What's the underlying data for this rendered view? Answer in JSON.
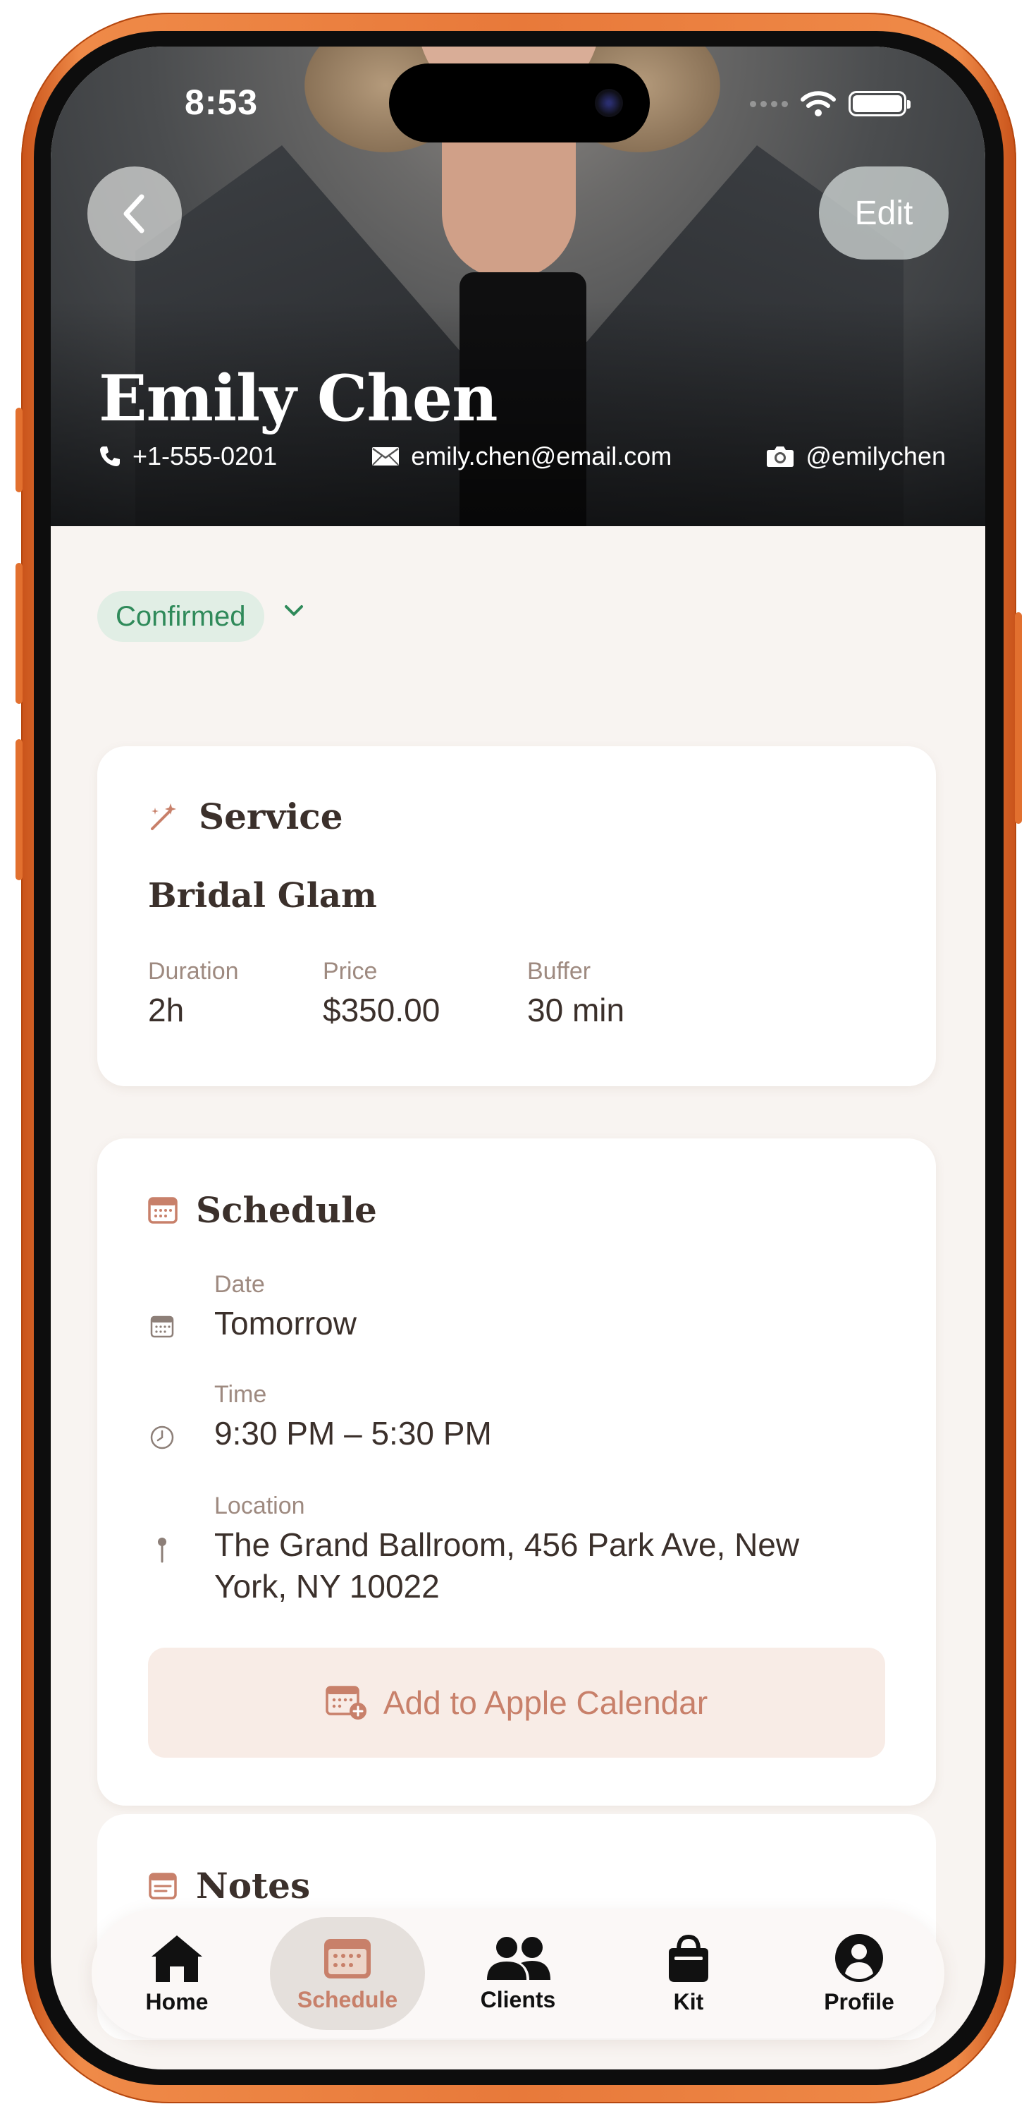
{
  "status_bar": {
    "time": "8:53"
  },
  "header": {
    "back_icon": "chevron-left-icon",
    "edit_label": "Edit",
    "name": "Emily Chen",
    "phone": "+1-555-0201",
    "email": "emily.chen@email.com",
    "instagram": "@emilychen"
  },
  "booking_status": {
    "label": "Confirmed",
    "color": "#2f8a5a"
  },
  "service": {
    "title": "Service",
    "name": "Bridal Glam",
    "stats": [
      {
        "label": "Duration",
        "value": "2h"
      },
      {
        "label": "Price",
        "value": "$350.00"
      },
      {
        "label": "Buffer",
        "value": "30 min"
      }
    ]
  },
  "schedule": {
    "title": "Schedule",
    "date_label": "Date",
    "date_value": "Tomorrow",
    "time_label": "Time",
    "time_value": "9:30 PM – 5:30 PM",
    "location_label": "Location",
    "location_value": "The Grand Ballroom, 456 Park Ave, New York, NY 10022",
    "calendar_button": "Add to Apple Calendar"
  },
  "notes": {
    "title": "Notes"
  },
  "tabbar": {
    "items": [
      {
        "label": "Home",
        "icon": "home-icon"
      },
      {
        "label": "Schedule",
        "icon": "calendar-icon"
      },
      {
        "label": "Clients",
        "icon": "clients-icon"
      },
      {
        "label": "Kit",
        "icon": "bag-icon"
      },
      {
        "label": "Profile",
        "icon": "profile-icon"
      }
    ],
    "active": "Schedule"
  },
  "colors": {
    "accent": "#c8806a",
    "background": "#f8f4f1",
    "text": "#3b302b"
  }
}
